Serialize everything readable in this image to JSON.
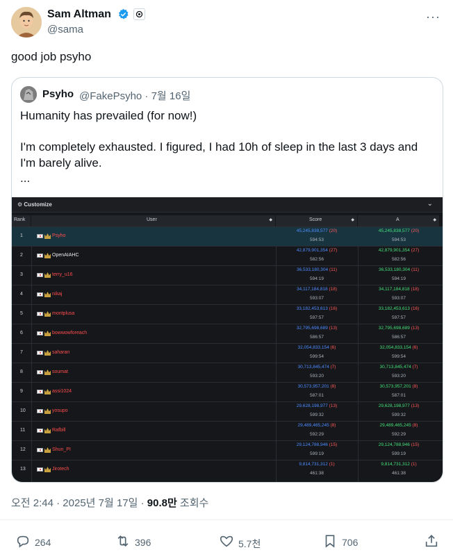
{
  "author": {
    "name": "Sam Altman",
    "handle": "@sama"
  },
  "tweet": {
    "text": "good job psyho"
  },
  "quote": {
    "name": "Psyho",
    "handle": "@FakePsyho · 7월 16일",
    "text": "Humanity has prevailed (for now!)\n\nI'm completely exhausted. I figured, I had 10h of sleep in the last 3 days and I'm barely alive.\n..."
  },
  "board": {
    "customize": "Customize",
    "headers": {
      "rank": "Rank",
      "user": "User",
      "score": "Score",
      "a": "A"
    },
    "rows": [
      {
        "rank": "1",
        "user": "Psyho",
        "score": "45,245,838,577",
        "sub": "(20)",
        "time": "594:53"
      },
      {
        "rank": "2",
        "user": "OpenAIAHC",
        "score": "42,879,901,354",
        "sub": "(27)",
        "time": "582:56"
      },
      {
        "rank": "3",
        "user": "terry_u16",
        "score": "36,533,180,304",
        "sub": "(11)",
        "time": "594:19"
      },
      {
        "rank": "4",
        "user": "nikaj",
        "score": "34,117,184,818",
        "sub": "(18)",
        "time": "593:07"
      },
      {
        "rank": "5",
        "user": "montplusa",
        "score": "33,182,453,613",
        "sub": "(16)",
        "time": "597:57"
      },
      {
        "rank": "6",
        "user": "bowwowforeach",
        "score": "32,795,698,689",
        "sub": "(13)",
        "time": "586:57"
      },
      {
        "rank": "7",
        "user": "saharan",
        "score": "32,054,833,154",
        "sub": "(6)",
        "time": "599:54"
      },
      {
        "rank": "8",
        "user": "soumat",
        "score": "30,713,845,474",
        "sub": "(7)",
        "time": "593:20"
      },
      {
        "rank": "9",
        "user": "assi1024",
        "score": "30,573,957,201",
        "sub": "(8)",
        "time": "587:01"
      },
      {
        "rank": "10",
        "user": "yosupo",
        "score": "29,628,198,977",
        "sub": "(13)",
        "time": "599:32"
      },
      {
        "rank": "11",
        "user": "Rafbill",
        "score": "29,489,465,245",
        "sub": "(8)",
        "time": "592:29"
      },
      {
        "rank": "12",
        "user": "Shun_PI",
        "score": "29,124,788,946",
        "sub": "(15)",
        "time": "599:19"
      },
      {
        "rank": "13",
        "user": "Jirotech",
        "score": "9,814,731,312",
        "sub": "(1)",
        "time": "461:38"
      }
    ]
  },
  "meta": {
    "time": "오전 2:44 · 2025년 7월 17일 · ",
    "views": "90.8만",
    "views_label": " 조회수"
  },
  "actions": {
    "replies": "264",
    "reposts": "396",
    "likes": "5.7천",
    "bookmarks": "706"
  }
}
